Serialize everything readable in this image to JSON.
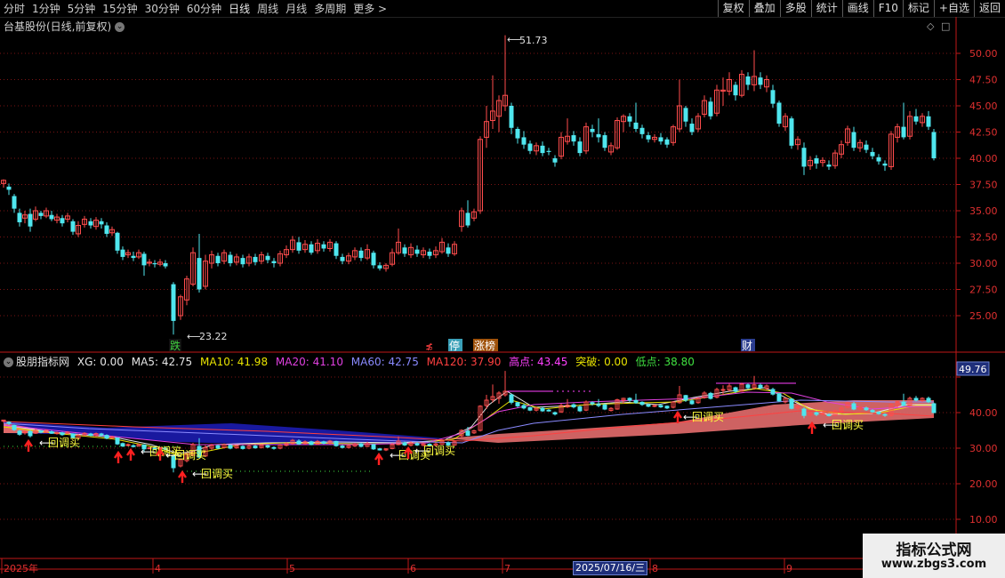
{
  "toolbar": {
    "periods": [
      "分时",
      "1分钟",
      "5分钟",
      "15分钟",
      "30分钟",
      "60分钟",
      "日线",
      "周线",
      "月线",
      "多周期",
      "更多 >"
    ],
    "active_period": "日线",
    "tools": [
      "复权",
      "叠加",
      "多股",
      "统计",
      "画线",
      "F10",
      "标记",
      "+自选",
      "返回"
    ]
  },
  "main_title": "台基股份(日线,前复权)",
  "price_axis": [
    "50.00",
    "47.50",
    "45.00",
    "42.50",
    "40.00",
    "37.50",
    "35.00",
    "32.50",
    "30.00",
    "27.50",
    "25.00"
  ],
  "price_high": "51.73",
  "price_low": "23.22",
  "markers": {
    "die": "跌",
    "ting": "停",
    "zhangbang": "涨榜",
    "cai": "财",
    "small": "≴"
  },
  "indicator": {
    "name": "股朋指标网",
    "items": [
      {
        "label": "XG: 0.00",
        "color": "#e6e6e6"
      },
      {
        "label": "MA5: 42.75",
        "color": "#e6e6e6"
      },
      {
        "label": "MA10: 41.98",
        "color": "#e8e300"
      },
      {
        "label": "MA20: 41.10",
        "color": "#e040e0"
      },
      {
        "label": "MA60: 42.75",
        "color": "#8a8aff"
      },
      {
        "label": "MA120: 37.90",
        "color": "#ff4040"
      },
      {
        "label": "高点: 43.45",
        "color": "#ff40ff"
      },
      {
        "label": "突破: 0.00",
        "color": "#e8e300"
      },
      {
        "label": "低点: 38.80",
        "color": "#40e040"
      }
    ],
    "axis": [
      "40.00",
      "30.00",
      "20.00",
      "10.00"
    ],
    "axis_top": "49.76",
    "signal": "回调买"
  },
  "xaxis": {
    "labels": [
      "2025年",
      "4",
      "5",
      "6",
      "7",
      "8",
      "9"
    ],
    "highlight": "2025/07/16/三"
  },
  "watermark": {
    "line1": "指标公式网",
    "line2": "www.zbgs3.com"
  },
  "colors": {
    "up": "#ff4d4d",
    "down": "#4fe6ee",
    "grid": "#7a1414",
    "axis": "#c01818"
  }
}
